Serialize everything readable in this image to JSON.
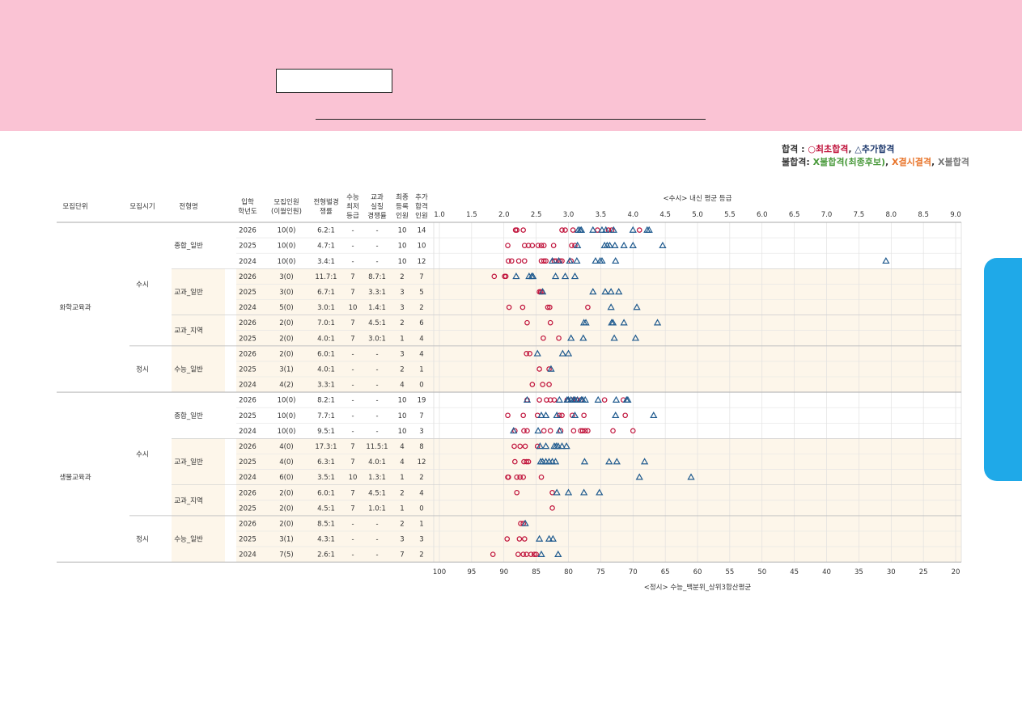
{
  "legend": {
    "pass_label": "합격",
    "pass_sep": " : ",
    "pass_first": "○최초합격",
    "pass_comma": ", ",
    "pass_added": "△추가합격",
    "fail_label": "불합격: ",
    "fail_a": "X불합격(최종후보)",
    "fail_comma1": ", ",
    "fail_b": "X결시결격",
    "fail_comma2": ", ",
    "fail_c": "X불합격"
  },
  "chart_data": {
    "type": "scatter",
    "headers": {
      "unit": "모집단위",
      "time": "모집시기",
      "type": "전형명",
      "year": [
        "입학",
        "학년도"
      ],
      "quota": [
        "모집인원",
        "(이월인원)"
      ],
      "ratio": [
        "전형별경",
        "쟁률"
      ],
      "min": [
        "수능",
        "최저",
        "등급"
      ],
      "real": [
        "교과",
        "실질",
        "경쟁률"
      ],
      "reg": [
        "최종",
        "등록",
        "인원"
      ],
      "add": [
        "추가",
        "합격",
        "인원"
      ]
    },
    "top_axis": {
      "label": "<수시> 내신 평균 등급",
      "min": 1.0,
      "max": 9.0,
      "ticks": [
        "1.0",
        "1.5",
        "2.0",
        "2.5",
        "3.0",
        "3.5",
        "4.0",
        "4.5",
        "5.0",
        "5.5",
        "6.0",
        "6.5",
        "7.0",
        "7.5",
        "8.0",
        "8.5",
        "9.0"
      ]
    },
    "bottom_axis": {
      "label": "<정시> 수능_백분위_상위3합산평균",
      "min": 20,
      "max": 100,
      "reversed": true,
      "ticks": [
        "100",
        "95",
        "90",
        "85",
        "80",
        "75",
        "70",
        "65",
        "60",
        "55",
        "50",
        "45",
        "40",
        "35",
        "30",
        "25",
        "20"
      ]
    },
    "units": [
      {
        "name": "화학교육과",
        "times": [
          {
            "name": "수시",
            "types": [
              {
                "name": "종합_일반",
                "rows": [
                  {
                    "year": "2026",
                    "quota": "10(0)",
                    "ratio": "6.2:1",
                    "min": "-",
                    "real": "-",
                    "reg": "10",
                    "add": "14",
                    "circles": [
                      2.18,
                      2.2,
                      2.3,
                      2.9,
                      2.95,
                      3.07,
                      3.45,
                      3.62,
                      3.67,
                      4.1
                    ],
                    "triangles": [
                      3.15,
                      3.18,
                      3.2,
                      3.38,
                      3.52,
                      3.58,
                      3.7,
                      4.0,
                      4.22,
                      4.25
                    ]
                  },
                  {
                    "year": "2025",
                    "quota": "10(0)",
                    "ratio": "4.7:1",
                    "min": "-",
                    "real": "-",
                    "reg": "10",
                    "add": "10",
                    "circles": [
                      2.06,
                      2.32,
                      2.38,
                      2.44,
                      2.53,
                      2.58,
                      2.62,
                      2.77,
                      3.05,
                      3.1
                    ],
                    "triangles": [
                      3.14,
                      3.56,
                      3.6,
                      3.64,
                      3.72,
                      3.86,
                      4.0,
                      4.46
                    ]
                  },
                  {
                    "year": "2024",
                    "quota": "10(0)",
                    "ratio": "3.4:1",
                    "min": "-",
                    "real": "-",
                    "reg": "10",
                    "add": "12",
                    "circles": [
                      2.07,
                      2.12,
                      2.23,
                      2.32,
                      2.58,
                      2.62,
                      2.65,
                      2.78,
                      2.81,
                      2.87,
                      2.9,
                      3.04
                    ],
                    "triangles": [
                      2.75,
                      2.85,
                      3.02,
                      3.13,
                      3.42,
                      3.49,
                      3.52,
                      3.73,
                      7.92
                    ]
                  }
                ]
              },
              {
                "name": "교과_일반",
                "rows": [
                  {
                    "year": "2026",
                    "quota": "3(0)",
                    "ratio": "11.7:1",
                    "min": "7",
                    "real": "8.7:1",
                    "reg": "2",
                    "add": "7",
                    "circles": [
                      1.85,
                      2.01,
                      2.03
                    ],
                    "triangles": [
                      2.19,
                      2.39,
                      2.43,
                      2.45,
                      2.8,
                      2.95,
                      3.1
                    ]
                  },
                  {
                    "year": "2025",
                    "quota": "3(0)",
                    "ratio": "6.7:1",
                    "min": "7",
                    "real": "3.3:1",
                    "reg": "3",
                    "add": "5",
                    "circles": [
                      2.55,
                      2.57,
                      2.59
                    ],
                    "triangles": [
                      2.6,
                      3.38,
                      3.57,
                      3.66,
                      3.78
                    ]
                  },
                  {
                    "year": "2024",
                    "quota": "5(0)",
                    "ratio": "3.0:1",
                    "min": "10",
                    "real": "1.4:1",
                    "reg": "3",
                    "add": "2",
                    "circles": [
                      2.08,
                      2.29,
                      2.68,
                      2.71,
                      3.3
                    ],
                    "triangles": [
                      3.66,
                      4.06
                    ]
                  }
                ]
              },
              {
                "name": "교과_지역",
                "rows": [
                  {
                    "year": "2026",
                    "quota": "2(0)",
                    "ratio": "7.0:1",
                    "min": "7",
                    "real": "4.5:1",
                    "reg": "2",
                    "add": "6",
                    "circles": [
                      2.36,
                      2.72
                    ],
                    "triangles": [
                      3.24,
                      3.27,
                      3.67,
                      3.69,
                      3.86,
                      4.38
                    ]
                  },
                  {
                    "year": "2025",
                    "quota": "2(0)",
                    "ratio": "4.0:1",
                    "min": "7",
                    "real": "3.0:1",
                    "reg": "1",
                    "add": "4",
                    "circles": [
                      2.61,
                      2.85
                    ],
                    "triangles": [
                      3.04,
                      3.23,
                      3.71,
                      4.04
                    ]
                  }
                ]
              }
            ]
          },
          {
            "name": "정시",
            "types": [
              {
                "name": "수능_일반",
                "rows": [
                  {
                    "year": "2026",
                    "quota": "2(0)",
                    "ratio": "6.0:1",
                    "min": "-",
                    "real": "-",
                    "reg": "3",
                    "add": "4",
                    "circles": [
                      86.5,
                      86.0
                    ],
                    "triangles": [
                      84.8,
                      80.9,
                      80.0
                    ]
                  },
                  {
                    "year": "2025",
                    "quota": "3(1)",
                    "ratio": "4.0:1",
                    "min": "-",
                    "real": "-",
                    "reg": "2",
                    "add": "1",
                    "circles": [
                      84.5,
                      83.0
                    ],
                    "triangles": [
                      82.7
                    ]
                  },
                  {
                    "year": "2024",
                    "quota": "4(2)",
                    "ratio": "3.3:1",
                    "min": "-",
                    "real": "-",
                    "reg": "4",
                    "add": "0",
                    "circles": [
                      85.6,
                      84.0,
                      83.0
                    ],
                    "triangles": []
                  }
                ]
              }
            ]
          }
        ]
      },
      {
        "name": "생물교육과",
        "times": [
          {
            "name": "수시",
            "types": [
              {
                "name": "종합_일반",
                "rows": [
                  {
                    "year": "2026",
                    "quota": "10(0)",
                    "ratio": "8.2:1",
                    "min": "-",
                    "real": "-",
                    "reg": "10",
                    "add": "19",
                    "circles": [
                      2.36,
                      2.55,
                      2.66,
                      2.72,
                      2.78,
                      2.98,
                      3.05,
                      3.12,
                      3.19,
                      3.56,
                      3.85
                    ],
                    "triangles": [
                      2.36,
                      2.86,
                      2.98,
                      3.0,
                      3.04,
                      3.08,
                      3.1,
                      3.14,
                      3.2,
                      3.22,
                      3.26,
                      3.46,
                      3.74,
                      3.9,
                      3.92
                    ]
                  },
                  {
                    "year": "2025",
                    "quota": "10(0)",
                    "ratio": "7.7:1",
                    "min": "-",
                    "real": "-",
                    "reg": "10",
                    "add": "7",
                    "circles": [
                      2.06,
                      2.3,
                      2.52,
                      2.86,
                      2.9,
                      3.06,
                      3.24,
                      3.88
                    ],
                    "triangles": [
                      2.58,
                      2.65,
                      2.82,
                      3.1,
                      3.73,
                      4.32
                    ]
                  },
                  {
                    "year": "2024",
                    "quota": "10(0)",
                    "ratio": "9.5:1",
                    "min": "-",
                    "real": "-",
                    "reg": "10",
                    "add": "3",
                    "circles": [
                      2.17,
                      2.31,
                      2.36,
                      2.62,
                      2.72,
                      2.88,
                      3.08,
                      3.19,
                      3.22,
                      3.26,
                      3.3,
                      3.69,
                      4.0
                    ],
                    "triangles": [
                      2.15,
                      2.53,
                      2.86
                    ]
                  }
                ]
              },
              {
                "name": "교과_일반",
                "rows": [
                  {
                    "year": "2026",
                    "quota": "4(0)",
                    "ratio": "17.3:1",
                    "min": "7",
                    "real": "11.5:1",
                    "reg": "4",
                    "add": "8",
                    "circles": [
                      2.16,
                      2.25,
                      2.33,
                      2.52
                    ],
                    "triangles": [
                      2.56,
                      2.65,
                      2.78,
                      2.81,
                      2.84,
                      2.9,
                      2.97
                    ]
                  },
                  {
                    "year": "2025",
                    "quota": "4(0)",
                    "ratio": "6.3:1",
                    "min": "7",
                    "real": "4.0:1",
                    "reg": "4",
                    "add": "12",
                    "circles": [
                      2.17,
                      2.31,
                      2.35,
                      2.38
                    ],
                    "triangles": [
                      2.57,
                      2.6,
                      2.65,
                      2.7,
                      2.75,
                      2.8,
                      3.25,
                      3.63,
                      3.75,
                      4.18
                    ]
                  },
                  {
                    "year": "2024",
                    "quota": "6(0)",
                    "ratio": "3.5:1",
                    "min": "10",
                    "real": "1.3:1",
                    "reg": "1",
                    "add": "2",
                    "circles": [
                      2.06,
                      2.07,
                      2.2,
                      2.25,
                      2.3,
                      2.58
                    ],
                    "triangles": [
                      4.1,
                      4.9
                    ]
                  }
                ]
              },
              {
                "name": "교과_지역",
                "rows": [
                  {
                    "year": "2026",
                    "quota": "2(0)",
                    "ratio": "6.0:1",
                    "min": "7",
                    "real": "4.5:1",
                    "reg": "2",
                    "add": "4",
                    "circles": [
                      2.2,
                      2.75
                    ],
                    "triangles": [
                      2.82,
                      3.0,
                      3.24,
                      3.48
                    ]
                  },
                  {
                    "year": "2025",
                    "quota": "2(0)",
                    "ratio": "4.5:1",
                    "min": "7",
                    "real": "1.0:1",
                    "reg": "1",
                    "add": "0",
                    "circles": [
                      2.75
                    ],
                    "triangles": []
                  }
                ]
              }
            ]
          },
          {
            "name": "정시",
            "types": [
              {
                "name": "수능_일반",
                "rows": [
                  {
                    "year": "2026",
                    "quota": "2(0)",
                    "ratio": "8.5:1",
                    "min": "-",
                    "real": "-",
                    "reg": "2",
                    "add": "1",
                    "circles": [
                      87.4,
                      87.0
                    ],
                    "triangles": [
                      86.7
                    ]
                  },
                  {
                    "year": "2025",
                    "quota": "3(1)",
                    "ratio": "4.3:1",
                    "min": "-",
                    "real": "-",
                    "reg": "3",
                    "add": "3",
                    "circles": [
                      89.5,
                      87.6,
                      86.8
                    ],
                    "triangles": [
                      84.5,
                      83.0,
                      82.4
                    ]
                  },
                  {
                    "year": "2024",
                    "quota": "7(5)",
                    "ratio": "2.6:1",
                    "min": "-",
                    "real": "-",
                    "reg": "7",
                    "add": "2",
                    "circles": [
                      91.7,
                      87.8,
                      87.0,
                      86.5,
                      85.8,
                      85.3,
                      85.0
                    ],
                    "triangles": [
                      84.2,
                      81.6
                    ]
                  }
                ]
              }
            ]
          }
        ]
      }
    ]
  },
  "colors": {
    "circle": "#c0143c",
    "triangle": "#1f5a8e",
    "band": "#fdf6ea",
    "grid": "#dcdcdc",
    "text": "#333333"
  }
}
